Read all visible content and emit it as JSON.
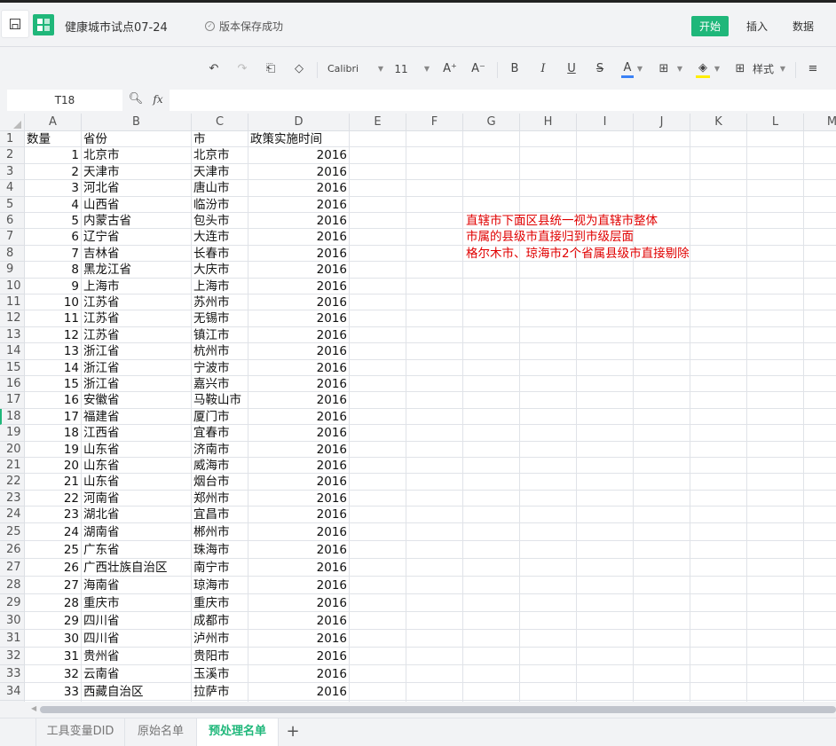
{
  "header": {
    "title": "健康城市试点07-24",
    "save_status": "版本保存成功",
    "menus": [
      "开始",
      "插入",
      "数据"
    ]
  },
  "toolbar": {
    "font": "Calibri",
    "size": "11",
    "inc": "A⁺",
    "dec": "A⁻",
    "bold": "B",
    "italic": "I",
    "underline": "U",
    "strike": "S",
    "fontcolor": "A",
    "style_label": "样式",
    "font_color": "#3b82f6",
    "fill_color": "#ffee00"
  },
  "formula": {
    "cell_ref": "T18",
    "fx": "fx",
    "value": ""
  },
  "columns": [
    "A",
    "B",
    "C",
    "D",
    "E",
    "F",
    "G",
    "H",
    "I",
    "J",
    "K",
    "L",
    "M"
  ],
  "headers": [
    "数量",
    "省份",
    "市",
    "政策实施时间"
  ],
  "rows": [
    [
      1,
      "北京市",
      "北京市",
      2016
    ],
    [
      2,
      "天津市",
      "天津市",
      2016
    ],
    [
      3,
      "河北省",
      "唐山市",
      2016
    ],
    [
      4,
      "山西省",
      "临汾市",
      2016
    ],
    [
      5,
      "内蒙古省",
      "包头市",
      2016
    ],
    [
      6,
      "辽宁省",
      "大连市",
      2016
    ],
    [
      7,
      "吉林省",
      "长春市",
      2016
    ],
    [
      8,
      "黑龙江省",
      "大庆市",
      2016
    ],
    [
      9,
      "上海市",
      "上海市",
      2016
    ],
    [
      10,
      "江苏省",
      "苏州市",
      2016
    ],
    [
      11,
      "江苏省",
      "无锡市",
      2016
    ],
    [
      12,
      "江苏省",
      "镇江市",
      2016
    ],
    [
      13,
      "浙江省",
      "杭州市",
      2016
    ],
    [
      14,
      "浙江省",
      "宁波市",
      2016
    ],
    [
      15,
      "浙江省",
      "嘉兴市",
      2016
    ],
    [
      16,
      "安徽省",
      "马鞍山市",
      2016
    ],
    [
      17,
      "福建省",
      "厦门市",
      2016
    ],
    [
      18,
      "江西省",
      "宜春市",
      2016
    ],
    [
      19,
      "山东省",
      "济南市",
      2016
    ],
    [
      20,
      "山东省",
      "威海市",
      2016
    ],
    [
      21,
      "山东省",
      "烟台市",
      2016
    ],
    [
      22,
      "河南省",
      "郑州市",
      2016
    ],
    [
      23,
      "湖北省",
      "宜昌市",
      2016
    ],
    [
      24,
      "湖南省",
      "郴州市",
      2016
    ],
    [
      25,
      "广东省",
      "珠海市",
      2016
    ],
    [
      26,
      "广西壮族自治区",
      "南宁市",
      2016
    ],
    [
      27,
      "海南省",
      "琼海市",
      2016
    ],
    [
      28,
      "重庆市",
      "重庆市",
      2016
    ],
    [
      29,
      "四川省",
      "成都市",
      2016
    ],
    [
      30,
      "四川省",
      "泸州市",
      2016
    ],
    [
      31,
      "贵州省",
      "贵阳市",
      2016
    ],
    [
      32,
      "云南省",
      "玉溪市",
      2016
    ],
    [
      33,
      "西藏自治区",
      "拉萨市",
      2016
    ]
  ],
  "notes": [
    "直辖市下面区县统一视为直辖市整体",
    "市属的县级市直接归到市级层面",
    "格尔木市、琼海市2个省属县级市直接剔除"
  ],
  "sheet_tabs": [
    "工具变量DID",
    "原始名单",
    "预处理名单"
  ],
  "selected_row": 18,
  "accent": "#1fb77a",
  "note_color": "#e00000"
}
